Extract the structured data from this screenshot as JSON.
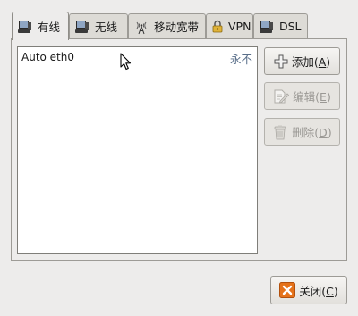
{
  "tabs": [
    {
      "label": "有线",
      "icon": "wired-network-icon"
    },
    {
      "label": "无线",
      "icon": "wireless-network-icon"
    },
    {
      "label": "移动宽带",
      "icon": "mobile-broadband-icon"
    },
    {
      "label": "VPN",
      "icon": "vpn-lock-icon"
    },
    {
      "label": "DSL",
      "icon": "dsl-network-icon"
    }
  ],
  "connections": {
    "items": [
      {
        "name": "Auto eth0",
        "last_used": "永不"
      }
    ]
  },
  "buttons": {
    "add_label": "添加(",
    "add_key": "A",
    "add_end": ")",
    "edit_label": "编辑(",
    "edit_key": "E",
    "edit_end": ")",
    "delete_label": "删除(",
    "delete_key": "D",
    "delete_end": ")",
    "close_label": "关闭(",
    "close_key": "C",
    "close_end": ")"
  },
  "colors": {
    "close_icon": "#e5721a",
    "last_used_text": "#5a6f8a"
  }
}
